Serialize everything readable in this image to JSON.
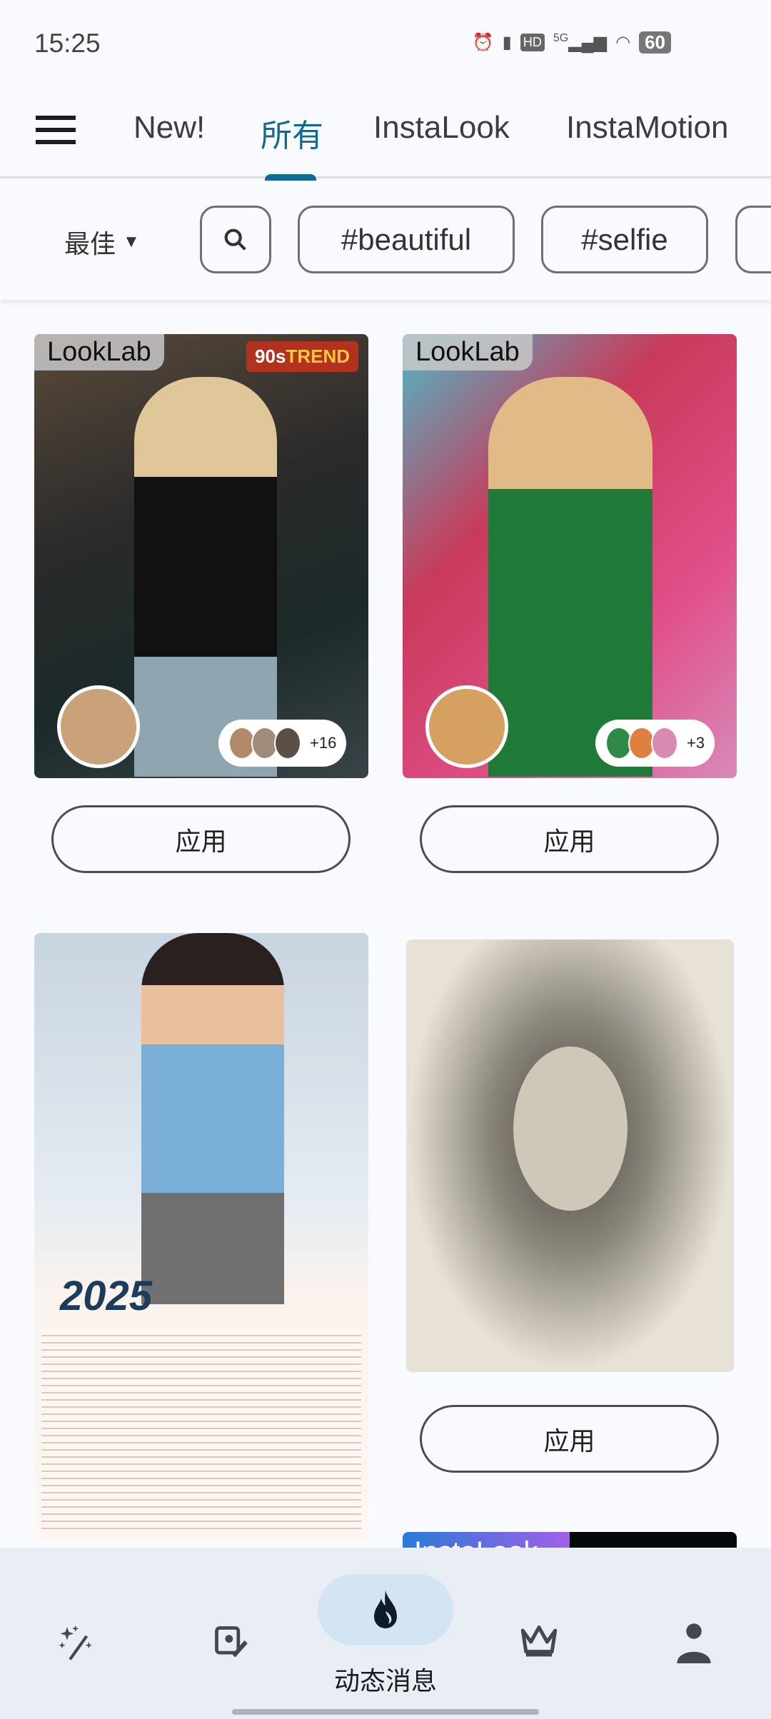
{
  "status_bar": {
    "time": "15:25",
    "network": "5G",
    "battery": "60"
  },
  "tabs": {
    "items": [
      {
        "label": "New!"
      },
      {
        "label": "所有",
        "active": true
      },
      {
        "label": "InstaLook"
      },
      {
        "label": "InstaMotion"
      }
    ],
    "accent": "#116a8f"
  },
  "filters": {
    "sort": "最佳",
    "tags": [
      "#beautiful",
      "#selfie"
    ]
  },
  "cards": [
    {
      "badge": "LookLab",
      "trend_prefix": "90s",
      "trend": "TREND",
      "count": "+16",
      "apply": "应用"
    },
    {
      "badge": "LookLab",
      "count": "+3",
      "apply": "应用"
    },
    {
      "calendar_year": "2025"
    },
    {
      "apply": "应用"
    },
    {
      "banner": "InstaLook"
    }
  ],
  "bottom_nav": {
    "items": [
      "magic-wand",
      "photo-edit",
      "flame",
      "crown",
      "person"
    ],
    "active_label": "动态消息",
    "active_color": "#d3e4f2"
  }
}
